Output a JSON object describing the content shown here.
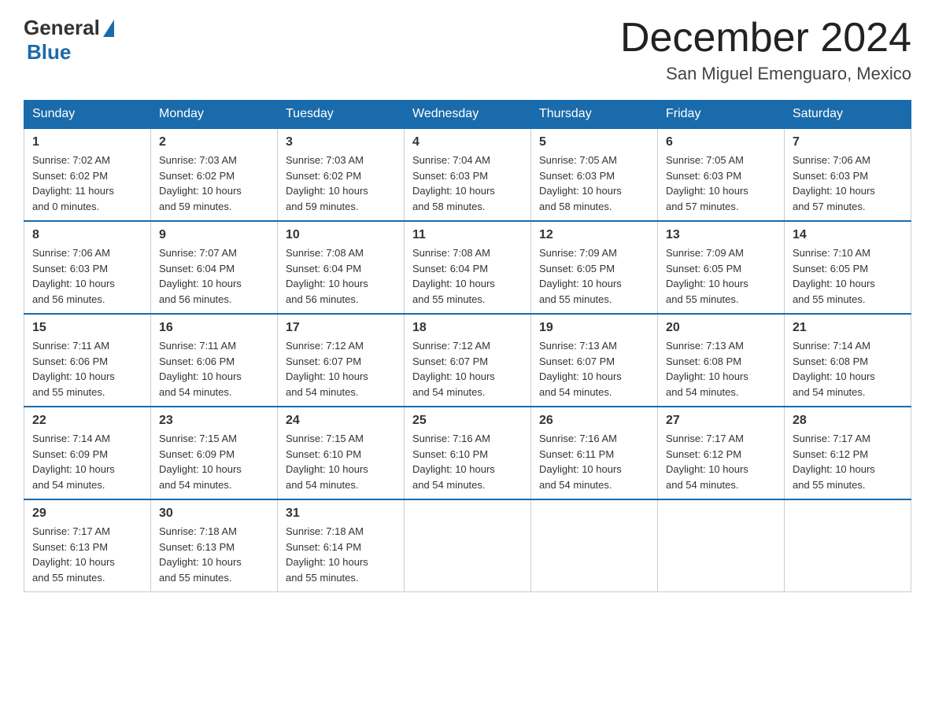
{
  "header": {
    "logo_general": "General",
    "logo_blue": "Blue",
    "title": "December 2024",
    "subtitle": "San Miguel Emenguaro, Mexico"
  },
  "days_of_week": [
    "Sunday",
    "Monday",
    "Tuesday",
    "Wednesday",
    "Thursday",
    "Friday",
    "Saturday"
  ],
  "weeks": [
    [
      {
        "day": "1",
        "info": "Sunrise: 7:02 AM\nSunset: 6:02 PM\nDaylight: 11 hours\nand 0 minutes."
      },
      {
        "day": "2",
        "info": "Sunrise: 7:03 AM\nSunset: 6:02 PM\nDaylight: 10 hours\nand 59 minutes."
      },
      {
        "day": "3",
        "info": "Sunrise: 7:03 AM\nSunset: 6:02 PM\nDaylight: 10 hours\nand 59 minutes."
      },
      {
        "day": "4",
        "info": "Sunrise: 7:04 AM\nSunset: 6:03 PM\nDaylight: 10 hours\nand 58 minutes."
      },
      {
        "day": "5",
        "info": "Sunrise: 7:05 AM\nSunset: 6:03 PM\nDaylight: 10 hours\nand 58 minutes."
      },
      {
        "day": "6",
        "info": "Sunrise: 7:05 AM\nSunset: 6:03 PM\nDaylight: 10 hours\nand 57 minutes."
      },
      {
        "day": "7",
        "info": "Sunrise: 7:06 AM\nSunset: 6:03 PM\nDaylight: 10 hours\nand 57 minutes."
      }
    ],
    [
      {
        "day": "8",
        "info": "Sunrise: 7:06 AM\nSunset: 6:03 PM\nDaylight: 10 hours\nand 56 minutes."
      },
      {
        "day": "9",
        "info": "Sunrise: 7:07 AM\nSunset: 6:04 PM\nDaylight: 10 hours\nand 56 minutes."
      },
      {
        "day": "10",
        "info": "Sunrise: 7:08 AM\nSunset: 6:04 PM\nDaylight: 10 hours\nand 56 minutes."
      },
      {
        "day": "11",
        "info": "Sunrise: 7:08 AM\nSunset: 6:04 PM\nDaylight: 10 hours\nand 55 minutes."
      },
      {
        "day": "12",
        "info": "Sunrise: 7:09 AM\nSunset: 6:05 PM\nDaylight: 10 hours\nand 55 minutes."
      },
      {
        "day": "13",
        "info": "Sunrise: 7:09 AM\nSunset: 6:05 PM\nDaylight: 10 hours\nand 55 minutes."
      },
      {
        "day": "14",
        "info": "Sunrise: 7:10 AM\nSunset: 6:05 PM\nDaylight: 10 hours\nand 55 minutes."
      }
    ],
    [
      {
        "day": "15",
        "info": "Sunrise: 7:11 AM\nSunset: 6:06 PM\nDaylight: 10 hours\nand 55 minutes."
      },
      {
        "day": "16",
        "info": "Sunrise: 7:11 AM\nSunset: 6:06 PM\nDaylight: 10 hours\nand 54 minutes."
      },
      {
        "day": "17",
        "info": "Sunrise: 7:12 AM\nSunset: 6:07 PM\nDaylight: 10 hours\nand 54 minutes."
      },
      {
        "day": "18",
        "info": "Sunrise: 7:12 AM\nSunset: 6:07 PM\nDaylight: 10 hours\nand 54 minutes."
      },
      {
        "day": "19",
        "info": "Sunrise: 7:13 AM\nSunset: 6:07 PM\nDaylight: 10 hours\nand 54 minutes."
      },
      {
        "day": "20",
        "info": "Sunrise: 7:13 AM\nSunset: 6:08 PM\nDaylight: 10 hours\nand 54 minutes."
      },
      {
        "day": "21",
        "info": "Sunrise: 7:14 AM\nSunset: 6:08 PM\nDaylight: 10 hours\nand 54 minutes."
      }
    ],
    [
      {
        "day": "22",
        "info": "Sunrise: 7:14 AM\nSunset: 6:09 PM\nDaylight: 10 hours\nand 54 minutes."
      },
      {
        "day": "23",
        "info": "Sunrise: 7:15 AM\nSunset: 6:09 PM\nDaylight: 10 hours\nand 54 minutes."
      },
      {
        "day": "24",
        "info": "Sunrise: 7:15 AM\nSunset: 6:10 PM\nDaylight: 10 hours\nand 54 minutes."
      },
      {
        "day": "25",
        "info": "Sunrise: 7:16 AM\nSunset: 6:10 PM\nDaylight: 10 hours\nand 54 minutes."
      },
      {
        "day": "26",
        "info": "Sunrise: 7:16 AM\nSunset: 6:11 PM\nDaylight: 10 hours\nand 54 minutes."
      },
      {
        "day": "27",
        "info": "Sunrise: 7:17 AM\nSunset: 6:12 PM\nDaylight: 10 hours\nand 54 minutes."
      },
      {
        "day": "28",
        "info": "Sunrise: 7:17 AM\nSunset: 6:12 PM\nDaylight: 10 hours\nand 55 minutes."
      }
    ],
    [
      {
        "day": "29",
        "info": "Sunrise: 7:17 AM\nSunset: 6:13 PM\nDaylight: 10 hours\nand 55 minutes."
      },
      {
        "day": "30",
        "info": "Sunrise: 7:18 AM\nSunset: 6:13 PM\nDaylight: 10 hours\nand 55 minutes."
      },
      {
        "day": "31",
        "info": "Sunrise: 7:18 AM\nSunset: 6:14 PM\nDaylight: 10 hours\nand 55 minutes."
      },
      null,
      null,
      null,
      null
    ]
  ]
}
